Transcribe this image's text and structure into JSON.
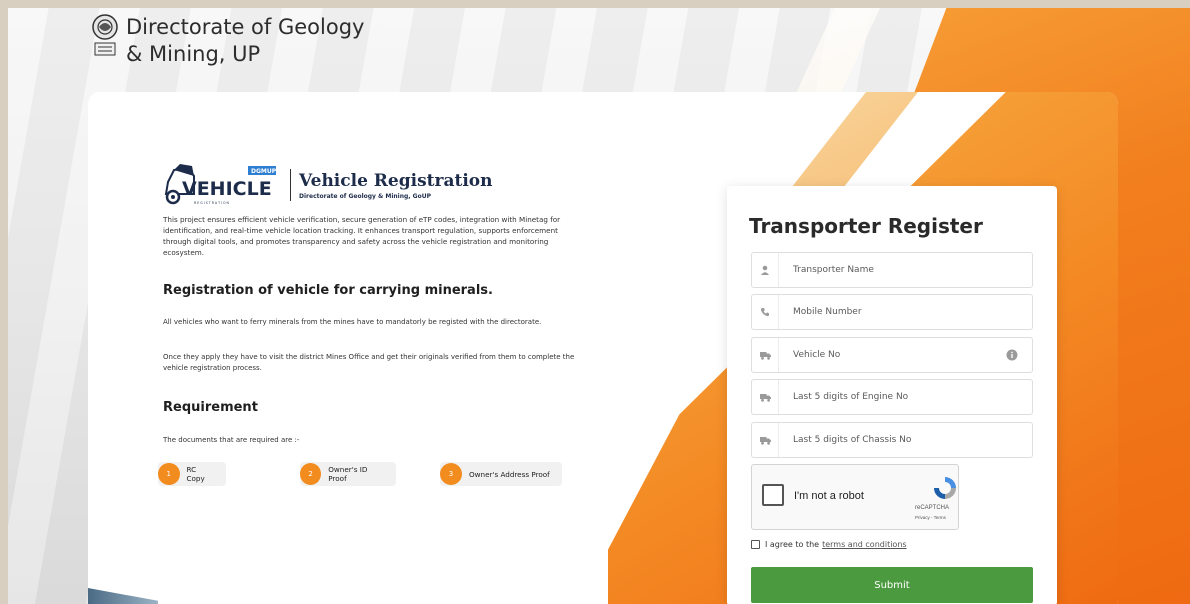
{
  "header": {
    "title_line1": "Directorate of Geology",
    "title_line2": "& Mining, UP"
  },
  "brand": {
    "logo_tag": "DGMUP",
    "logo_word": "VEHICLE",
    "logo_sub": "R E G I S T R A T I O N",
    "title": "Vehicle Registration",
    "subtitle": "Directorate of Geology & Mining, GoUP"
  },
  "content": {
    "intro": "This project ensures efficient vehicle verification, secure generation of eTP codes, integration with Minetag for identification, and real-time vehicle location tracking. It enhances transport regulation, supports enforcement through digital tools, and promotes transparency and safety across the vehicle registration and monitoring ecosystem.",
    "heading": "Registration of vehicle for carrying minerals.",
    "para1": "All vehicles who want to ferry minerals from the mines have to mandatorly be registed with the directorate.",
    "para2": "Once they apply they have to visit the district Mines Office and get their originals verified from them to complete the vehicle registration process.",
    "req_heading": "Requirement",
    "req_intro": "The documents that are required are :-",
    "documents": [
      {
        "num": "1",
        "label": "RC Copy"
      },
      {
        "num": "2",
        "label": "Owner's ID Proof"
      },
      {
        "num": "3",
        "label": "Owner's Address Proof"
      }
    ]
  },
  "form": {
    "title": "Transporter Register",
    "fields": {
      "name": {
        "placeholder": "Transporter Name",
        "icon": "user-icon"
      },
      "mobile": {
        "placeholder": "Mobile Number",
        "icon": "phone-icon"
      },
      "vehicle": {
        "placeholder": "Vehicle No",
        "icon": "truck-icon"
      },
      "engine": {
        "placeholder": "Last 5 digits of Engine No",
        "icon": "truck-icon"
      },
      "chassis": {
        "placeholder": "Last 5 digits of Chassis No",
        "icon": "truck-icon"
      }
    },
    "captcha": {
      "label": "I'm not a robot",
      "brand": "reCAPTCHA",
      "links": "Privacy - Terms"
    },
    "agree_text": "I agree to the",
    "agree_link": "terms and conditions",
    "submit_label": "Submit"
  },
  "colors": {
    "accent_orange": "#f28c1e",
    "submit_green": "#4c9a3f"
  }
}
